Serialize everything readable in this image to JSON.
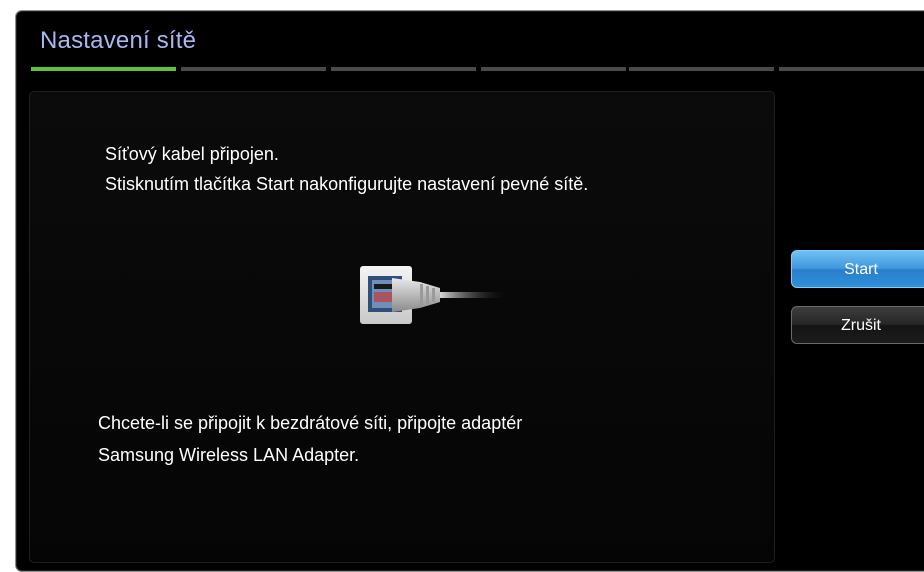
{
  "window": {
    "title": "Nastavení sítě"
  },
  "progress": {
    "total_steps": 6,
    "current_step": 1
  },
  "content": {
    "message_line1": "Síťový kabel připojen.",
    "message_line2": "Stisknutím tlačítka Start nakonfigurujte nastavení pevné sítě.",
    "wireless_note_line1": "Chcete-li se připojit k bezdrátové síti, připojte adaptér",
    "wireless_note_line2": "Samsung Wireless LAN Adapter.",
    "illustration_icon": "ethernet-cable-icon"
  },
  "buttons": {
    "start_label": "Start",
    "cancel_label": "Zrušit"
  },
  "colors": {
    "title": "#a9b8f2",
    "progress_active": "#5fc43a",
    "progress_inactive": "#4a4a4a",
    "start_button": "#3f98dd",
    "cancel_button": "#262626"
  }
}
